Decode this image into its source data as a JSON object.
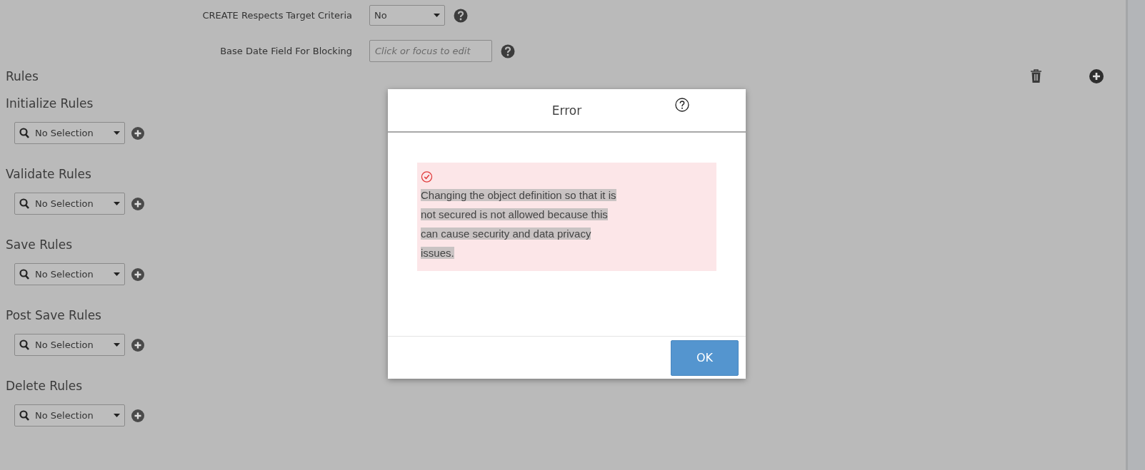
{
  "settings": [
    {
      "label": "CREATE Respects Target Criteria",
      "kind": "select",
      "value": "No"
    },
    {
      "label": "Base Date Field For Blocking",
      "kind": "input",
      "placeholder": "Click or focus to edit"
    }
  ],
  "rules": {
    "title": "Rules",
    "groups": [
      {
        "title": "Initialize Rules",
        "value": "No Selection"
      },
      {
        "title": "Validate Rules",
        "value": "No Selection"
      },
      {
        "title": "Save Rules",
        "value": "No Selection"
      },
      {
        "title": "Post Save Rules",
        "value": "No Selection"
      },
      {
        "title": "Delete Rules",
        "value": "No Selection"
      }
    ]
  },
  "dialog": {
    "title": "Error",
    "message": "Changing the object definition so that it is\nnot secured is not allowed because this\ncan cause security and data privacy\nissues.",
    "button": "OK"
  }
}
